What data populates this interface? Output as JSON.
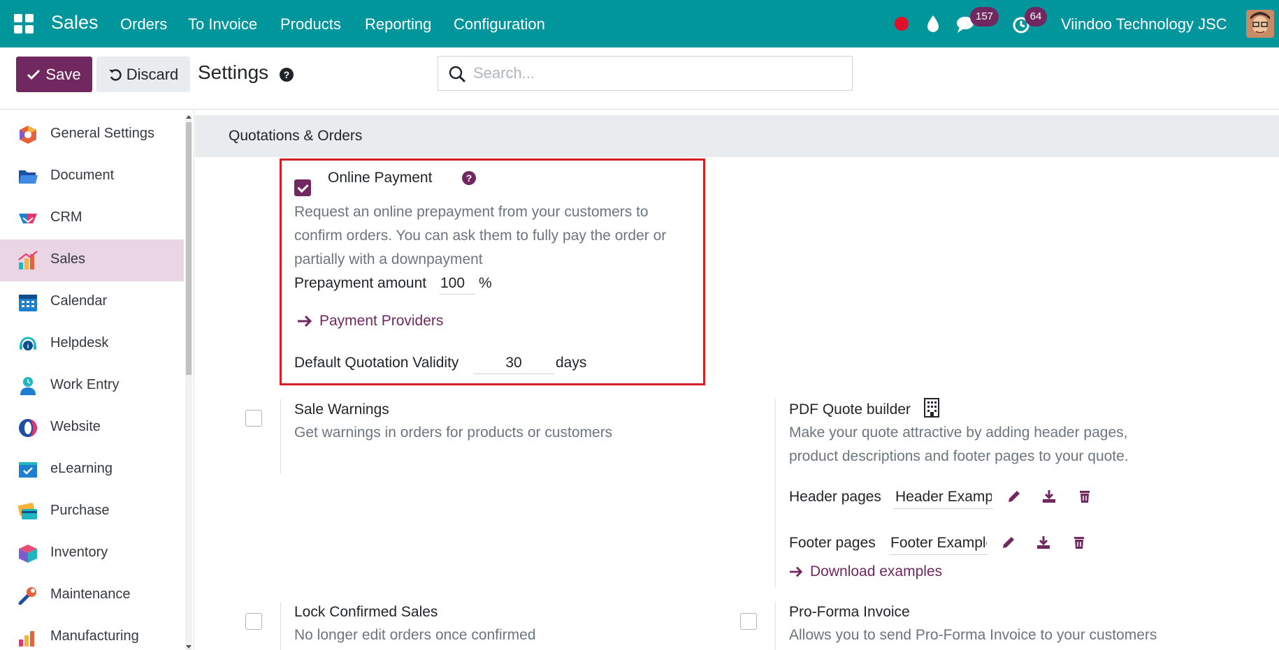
{
  "app": {
    "brand": "Sales",
    "menu": [
      "Orders",
      "To Invoice",
      "Products",
      "Reporting",
      "Configuration"
    ],
    "company": "Viindoo Technology JSC",
    "message_count": "157",
    "activity_count": "64"
  },
  "control_panel": {
    "save_label": "Save",
    "discard_label": "Discard",
    "title": "Settings",
    "search_placeholder": "Search..."
  },
  "sidebar": {
    "items": [
      {
        "label": "General Settings",
        "icon": "general-settings-icon"
      },
      {
        "label": "Document",
        "icon": "folder-icon"
      },
      {
        "label": "CRM",
        "icon": "handshake-icon"
      },
      {
        "label": "Sales",
        "icon": "sales-chart-icon",
        "active": true
      },
      {
        "label": "Calendar",
        "icon": "calendar-icon"
      },
      {
        "label": "Helpdesk",
        "icon": "headset-icon"
      },
      {
        "label": "Work Entry",
        "icon": "work-entry-icon"
      },
      {
        "label": "Website",
        "icon": "website-icon"
      },
      {
        "label": "eLearning",
        "icon": "elearning-icon"
      },
      {
        "label": "Purchase",
        "icon": "credit-card-icon"
      },
      {
        "label": "Inventory",
        "icon": "box-icon"
      },
      {
        "label": "Maintenance",
        "icon": "wrench-icon"
      },
      {
        "label": "Manufacturing",
        "icon": "factory-icon"
      }
    ]
  },
  "section": {
    "title": "Quotations & Orders"
  },
  "online_payment": {
    "title": "Online Payment",
    "checked": true,
    "description": "Request an online prepayment from your customers to confirm orders. You can ask them to fully pay the order or partially with a downpayment",
    "prepayment_label": "Prepayment amount",
    "prepayment_value": "100",
    "prepayment_unit": "%",
    "providers_link": "Payment Providers",
    "validity_label": "Default Quotation Validity",
    "validity_value": "30",
    "validity_unit": "days"
  },
  "sale_warnings": {
    "title": "Sale Warnings",
    "checked": false,
    "description": "Get warnings in orders for products or customers"
  },
  "pdf_quote": {
    "title": "PDF Quote builder",
    "description": "Make your quote attractive by adding header pages, product descriptions and footer pages to your quote.",
    "header_label": "Header pages",
    "header_value": "Header Example",
    "footer_label": "Footer pages",
    "footer_value": "Footer Example",
    "download_link": "Download examples"
  },
  "lock_sales": {
    "title": "Lock Confirmed Sales",
    "checked": false,
    "description": "No longer edit orders once confirmed"
  },
  "proforma": {
    "title": "Pro-Forma Invoice",
    "checked": false,
    "description": "Allows you to send Pro-Forma Invoice to your customers"
  },
  "colors": {
    "navbar": "#01959c",
    "primary": "#71275f",
    "highlight": "#d61e26",
    "sidebar_active": "#e9d5e4"
  }
}
